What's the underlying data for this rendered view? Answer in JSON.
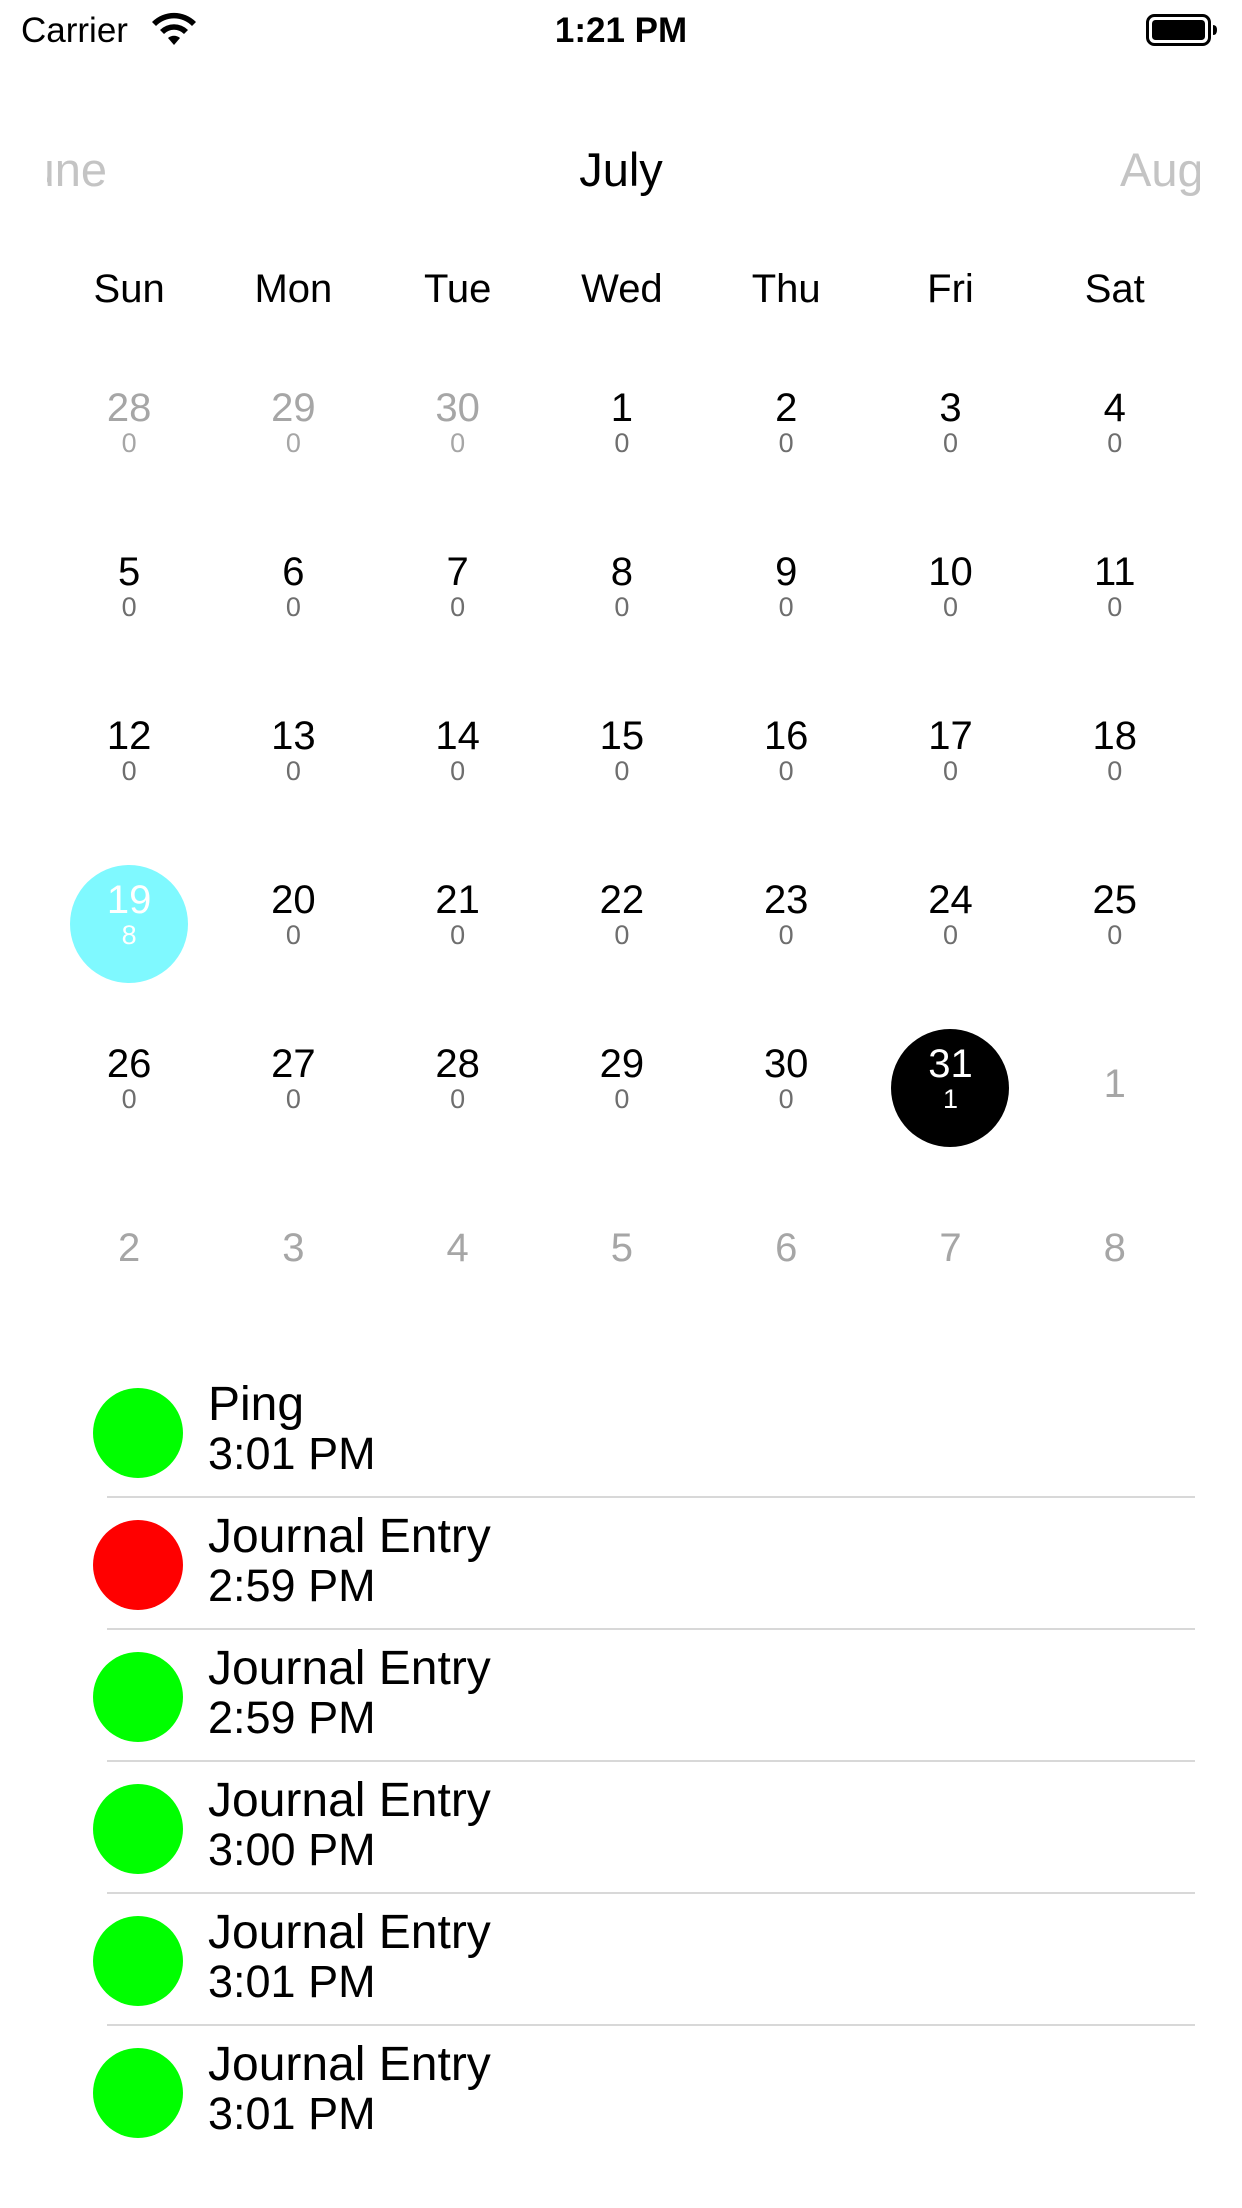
{
  "status": {
    "carrier": "Carrier",
    "time": "1:21 PM"
  },
  "header": {
    "prev_month": "June",
    "month": "July",
    "next_month": "August"
  },
  "weekdays": [
    "Sun",
    "Mon",
    "Tue",
    "Wed",
    "Thu",
    "Fri",
    "Sat"
  ],
  "weeks": [
    [
      {
        "day": "28",
        "count": "0",
        "other": true
      },
      {
        "day": "29",
        "count": "0",
        "other": true
      },
      {
        "day": "30",
        "count": "0",
        "other": true
      },
      {
        "day": "1",
        "count": "0"
      },
      {
        "day": "2",
        "count": "0"
      },
      {
        "day": "3",
        "count": "0"
      },
      {
        "day": "4",
        "count": "0"
      }
    ],
    [
      {
        "day": "5",
        "count": "0"
      },
      {
        "day": "6",
        "count": "0"
      },
      {
        "day": "7",
        "count": "0"
      },
      {
        "day": "8",
        "count": "0"
      },
      {
        "day": "9",
        "count": "0"
      },
      {
        "day": "10",
        "count": "0"
      },
      {
        "day": "11",
        "count": "0"
      }
    ],
    [
      {
        "day": "12",
        "count": "0"
      },
      {
        "day": "13",
        "count": "0"
      },
      {
        "day": "14",
        "count": "0"
      },
      {
        "day": "15",
        "count": "0"
      },
      {
        "day": "16",
        "count": "0"
      },
      {
        "day": "17",
        "count": "0"
      },
      {
        "day": "18",
        "count": "0"
      }
    ],
    [
      {
        "day": "19",
        "count": "8",
        "selected": "cyan"
      },
      {
        "day": "20",
        "count": "0"
      },
      {
        "day": "21",
        "count": "0"
      },
      {
        "day": "22",
        "count": "0"
      },
      {
        "day": "23",
        "count": "0"
      },
      {
        "day": "24",
        "count": "0"
      },
      {
        "day": "25",
        "count": "0"
      }
    ],
    [
      {
        "day": "26",
        "count": "0"
      },
      {
        "day": "27",
        "count": "0"
      },
      {
        "day": "28",
        "count": "0"
      },
      {
        "day": "29",
        "count": "0"
      },
      {
        "day": "30",
        "count": "0"
      },
      {
        "day": "31",
        "count": "1",
        "selected": "black"
      },
      {
        "day": "1",
        "other": true
      }
    ],
    [
      {
        "day": "2",
        "other": true
      },
      {
        "day": "3",
        "other": true
      },
      {
        "day": "4",
        "other": true
      },
      {
        "day": "5",
        "other": true
      },
      {
        "day": "6",
        "other": true
      },
      {
        "day": "7",
        "other": true
      },
      {
        "day": "8",
        "other": true
      }
    ]
  ],
  "colors": {
    "green": "#00ff00",
    "red": "#ff0000",
    "cyan": "#7ff9ff"
  },
  "events": [
    {
      "title": "Ping",
      "time": "3:01 PM",
      "color": "#00ff00"
    },
    {
      "title": "Journal Entry",
      "time": "2:59 PM",
      "color": "#ff0000"
    },
    {
      "title": "Journal Entry",
      "time": "2:59 PM",
      "color": "#00ff00"
    },
    {
      "title": "Journal Entry",
      "time": "3:00 PM",
      "color": "#00ff00"
    },
    {
      "title": "Journal Entry",
      "time": "3:01 PM",
      "color": "#00ff00"
    },
    {
      "title": "Journal Entry",
      "time": "3:01 PM",
      "color": "#00ff00"
    }
  ]
}
